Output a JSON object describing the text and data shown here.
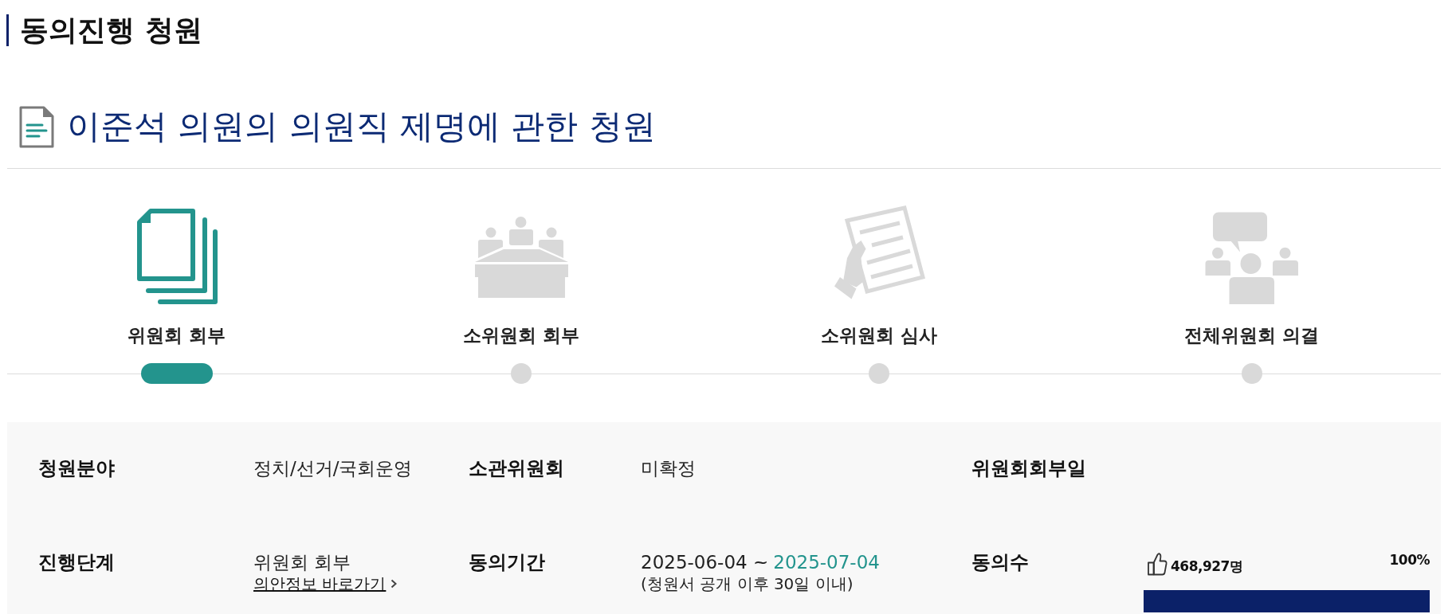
{
  "section_title": "동의진행 청원",
  "petition": {
    "title": "이준석 의원의 의원직 제명에 관한 청원"
  },
  "steps": [
    {
      "kind": "documents",
      "label": "위원회 회부",
      "selected": true
    },
    {
      "kind": "meeting",
      "label": "소위원회 회부",
      "selected": false
    },
    {
      "kind": "review",
      "label": "소위원회 심사",
      "selected": false
    },
    {
      "kind": "discussion",
      "label": "전체위원회 의결",
      "selected": false
    }
  ],
  "details": [
    {
      "kind": "text",
      "label": "청원분야",
      "value": "정치/선거/국회운영"
    },
    {
      "kind": "text",
      "label": "소관위원회",
      "value": "미확정"
    },
    {
      "kind": "text",
      "label": "위원회회부일"
    },
    {
      "kind": "stage",
      "label": "진행단계",
      "value": "위원회 회부",
      "link": "의안정보 바로가기"
    },
    {
      "kind": "period",
      "label": "동의기간",
      "start": "2025-06-04 ~",
      "end": "2025-07-04",
      "note": "(청원서 공개 이후 30일 이내)"
    },
    {
      "kind": "consent",
      "label": "동의수",
      "count": "468,927명",
      "percent": "100%",
      "level": 1
    }
  ]
}
